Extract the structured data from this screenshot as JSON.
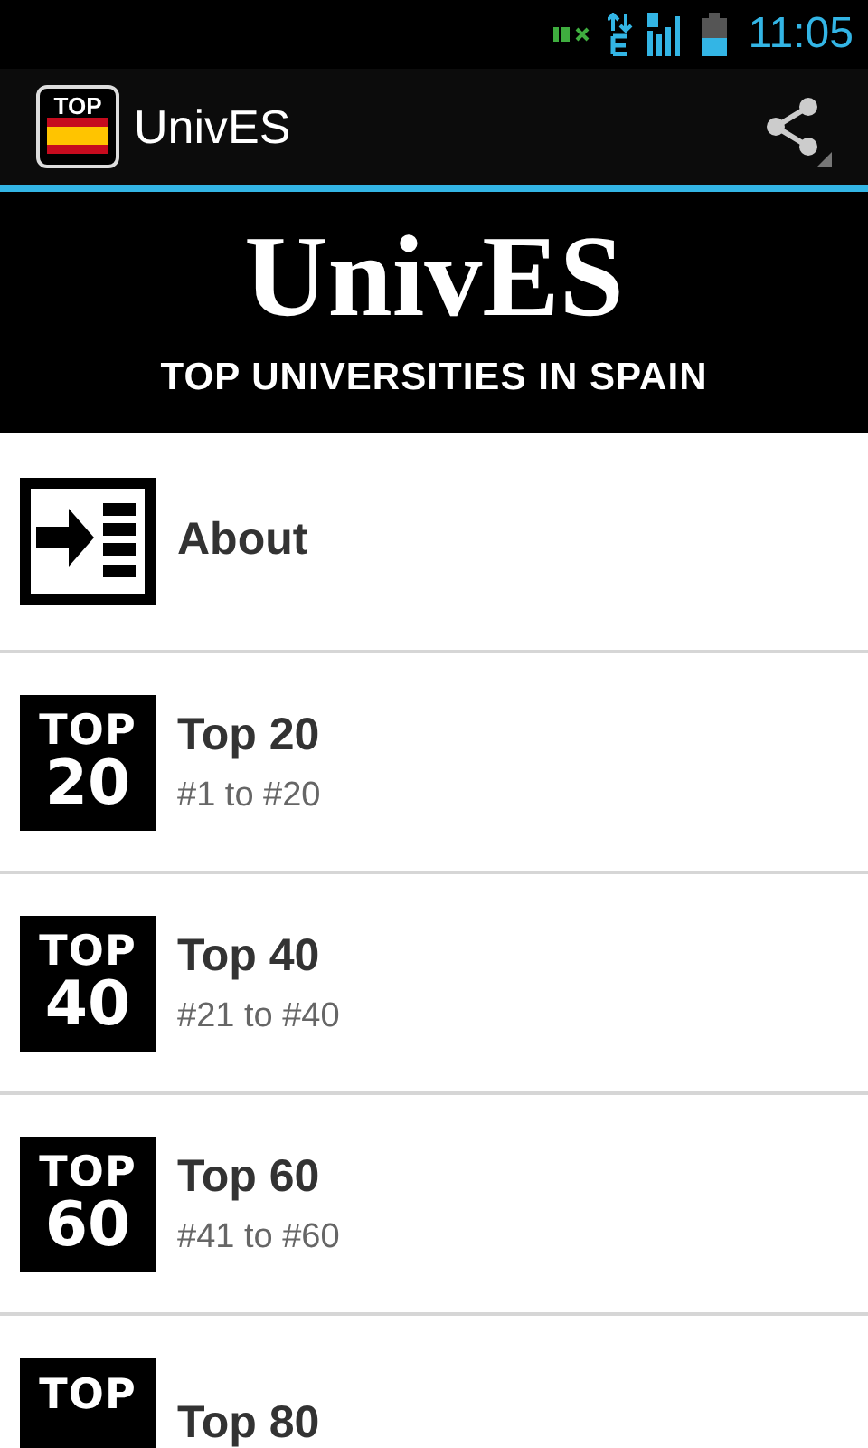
{
  "status_bar": {
    "time": "11:05"
  },
  "action_bar": {
    "app_icon_label": "TOP",
    "title": "UnivES"
  },
  "banner": {
    "title": "UnivES",
    "subtitle": "TOP UNIVERSITIES IN SPAIN"
  },
  "items": [
    {
      "kind": "about",
      "title": "About"
    },
    {
      "kind": "top",
      "badge_top": "TOP",
      "badge_number": "20",
      "title": "Top 20",
      "subtitle": "#1 to #20"
    },
    {
      "kind": "top",
      "badge_top": "TOP",
      "badge_number": "40",
      "title": "Top 40",
      "subtitle": "#21 to #40"
    },
    {
      "kind": "top",
      "badge_top": "TOP",
      "badge_number": "60",
      "title": "Top 60",
      "subtitle": "#41 to #60"
    },
    {
      "kind": "top",
      "badge_top": "TOP",
      "title": "Top 80"
    }
  ]
}
